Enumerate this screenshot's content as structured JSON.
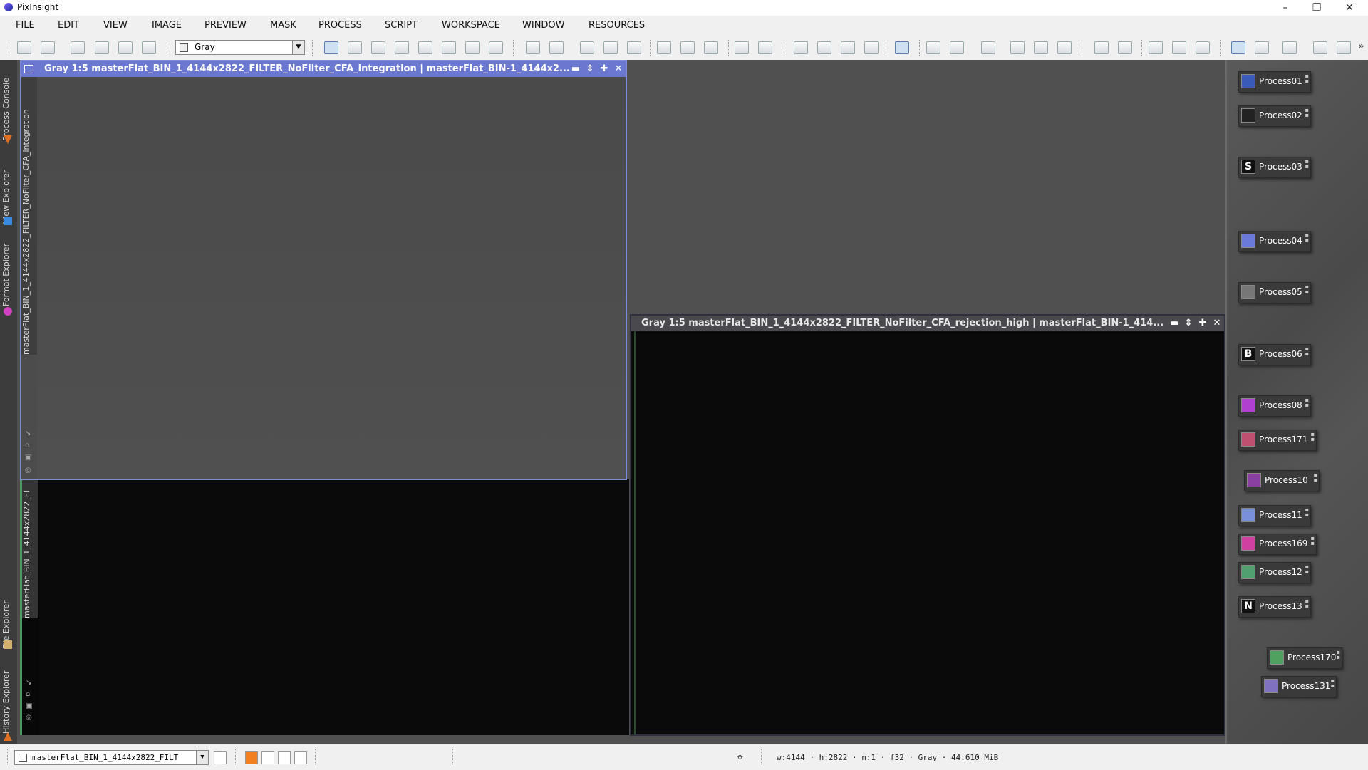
{
  "app": {
    "title": "PixInsight"
  },
  "window_controls": {
    "minimize": "–",
    "restore": "❐",
    "close": "✕"
  },
  "menu": [
    "FILE",
    "EDIT",
    "VIEW",
    "IMAGE",
    "PREVIEW",
    "MASK",
    "PROCESS",
    "SCRIPT",
    "WORKSPACE",
    "WINDOW",
    "RESOURCES"
  ],
  "toolbar": {
    "mask_mode": "Gray",
    "overflow": "»"
  },
  "left_dock": {
    "tabs": [
      "Process Console",
      "View Explorer",
      "Format Explorer",
      "File Explorer",
      "History Explorer"
    ]
  },
  "windows": {
    "integration": {
      "title": "Gray 1:5 masterFlat_BIN_1_4144x2822_FILTER_NoFilter_CFA_integration | masterFlat_BIN-1_4144x2...",
      "side_tab": "masterFlat_BIN_1_4144x2822_FILTER_NoFilter_CFA_integration"
    },
    "rejection_low": {
      "side_tab": "masterFlat_BIN_1_4144x2822_FI"
    },
    "rejection_high": {
      "title": "Gray 1:5 masterFlat_BIN_1_4144x2822_FILTER_NoFilter_CFA_rejection_high | masterFlat_BIN-1_414..."
    }
  },
  "process_icons": [
    {
      "label": "Process01",
      "glyph": "",
      "color": "#3a5ab8"
    },
    {
      "label": "Process02",
      "glyph": "",
      "color": "#222222"
    },
    {
      "label": "Process03",
      "glyph": "S",
      "color": "#111111"
    },
    {
      "label": "Process04",
      "glyph": "",
      "color": "#6a7ad8"
    },
    {
      "label": "Process05",
      "glyph": "",
      "color": "#777777"
    },
    {
      "label": "Process06",
      "glyph": "B",
      "color": "#111111"
    },
    {
      "label": "Process08",
      "glyph": "",
      "color": "#b040d0"
    },
    {
      "label": "Process171",
      "glyph": "",
      "color": "#c05070"
    },
    {
      "label": "Process10",
      "glyph": "",
      "color": "#8a40a0"
    },
    {
      "label": "Process11",
      "glyph": "",
      "color": "#7a90d8"
    },
    {
      "label": "Process169",
      "glyph": "",
      "color": "#d040a0"
    },
    {
      "label": "Process12",
      "glyph": "",
      "color": "#50a070"
    },
    {
      "label": "Process13",
      "glyph": "N",
      "color": "#111111"
    },
    {
      "label": "Process170",
      "glyph": "",
      "color": "#50a060"
    },
    {
      "label": "Process131",
      "glyph": "",
      "color": "#8070c0"
    }
  ],
  "status": {
    "view_selector": "masterFlat_BIN_1_4144x2822_FILT",
    "info": "w:4144 · h:2822 · n:1 · f32 · Gray · 44.610 MiB"
  },
  "colors": {
    "active_frame": "#7f8bd8",
    "inactive_frame": "#2e3040",
    "workspace": "#505050",
    "image_light": "#4c4c4c",
    "image_dark": "#0a0a0a"
  }
}
